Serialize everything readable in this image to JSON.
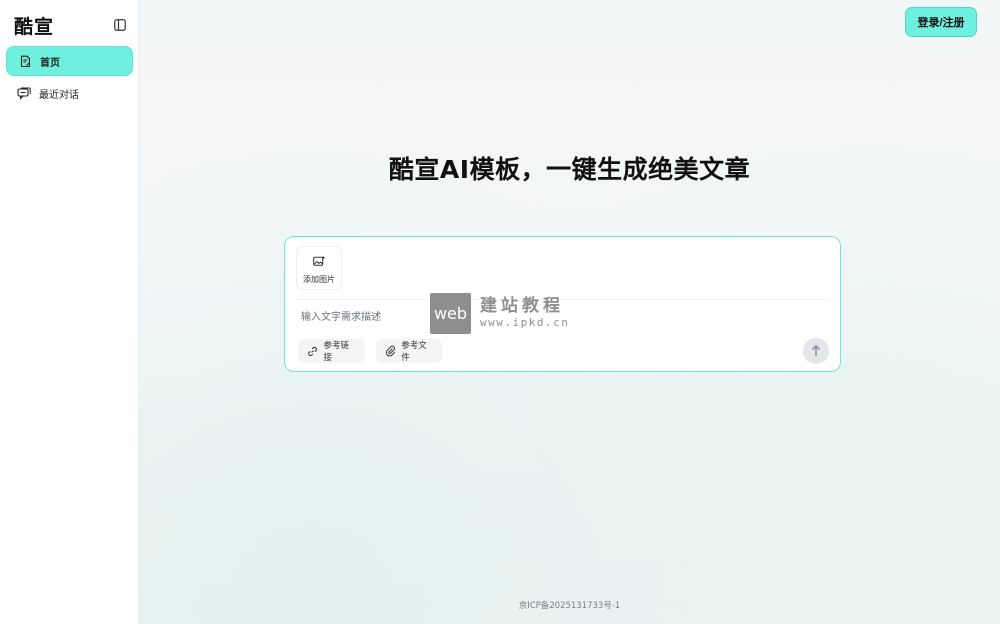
{
  "brand": "酷宣",
  "sidebar": {
    "items": [
      {
        "label": "首页",
        "icon": "document-edit-icon",
        "active": true
      },
      {
        "label": "最近对话",
        "icon": "chat-history-icon",
        "active": false
      }
    ]
  },
  "header": {
    "login_label": "登录/注册"
  },
  "main": {
    "headline": "酷宣AI模板，一键生成绝美文章"
  },
  "composer": {
    "add_image_label": "添加图片",
    "input_placeholder": "输入文字需求描述",
    "reference_link_label": "参考链接",
    "reference_file_label": "参考文件"
  },
  "watermark": {
    "box": "web",
    "cn": "建站教程",
    "url": "www.ipkd.cn"
  },
  "footer": {
    "icp": "京ICP备2025131733号-1"
  },
  "colors": {
    "accent": "#6ff0df",
    "accent_border": "#6fe6d6"
  }
}
